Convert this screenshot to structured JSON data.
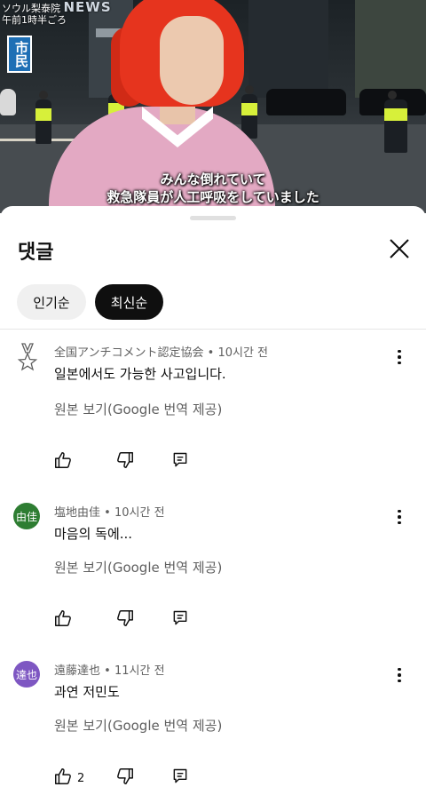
{
  "video": {
    "channel_small": "ソウル梨泰院",
    "channel_big": "NEWS",
    "timestamp_caption": "午前1時半ごろ",
    "side_tag": "市民",
    "subtitle_line1": "みんな倒れていて",
    "subtitle_line2": "救急隊員が人工呼吸をしていました"
  },
  "sheet": {
    "title": "댓글",
    "close_icon": "close-x-icon",
    "sort_chips": [
      {
        "label": "인기순",
        "selected": false
      },
      {
        "label": "최신순",
        "selected": true
      }
    ]
  },
  "comments": [
    {
      "author": "全国アンチコメント認定協会",
      "time": "10시간 전",
      "avatar_type": "medal-icon",
      "avatar_text": "",
      "avatar_color": "",
      "text": "일본에서도 가능한 사고입니다.",
      "translate_link": "원본 보기(Google 번역 제공)",
      "like_count": ""
    },
    {
      "author": "塩地由佳",
      "time": "10시간 전",
      "avatar_type": "letter",
      "avatar_text": "由佳",
      "avatar_color": "#2e7d32",
      "text": "마음의 독에...",
      "translate_link": "원본 보기(Google 번역 제공)",
      "like_count": ""
    },
    {
      "author": "遠藤達也",
      "time": "11시간 전",
      "avatar_type": "letter",
      "avatar_text": "達也",
      "avatar_color": "#7e57c2",
      "text": "과연 저민도",
      "translate_link": "원본 보기(Google 번역 제공)",
      "like_count": "2"
    }
  ],
  "separator": "•",
  "colors": {
    "text_primary": "#0f0f0f",
    "text_secondary": "#606060",
    "chip_selected": "#0f0f0f",
    "chip_unselected": "#f0f0f0"
  }
}
